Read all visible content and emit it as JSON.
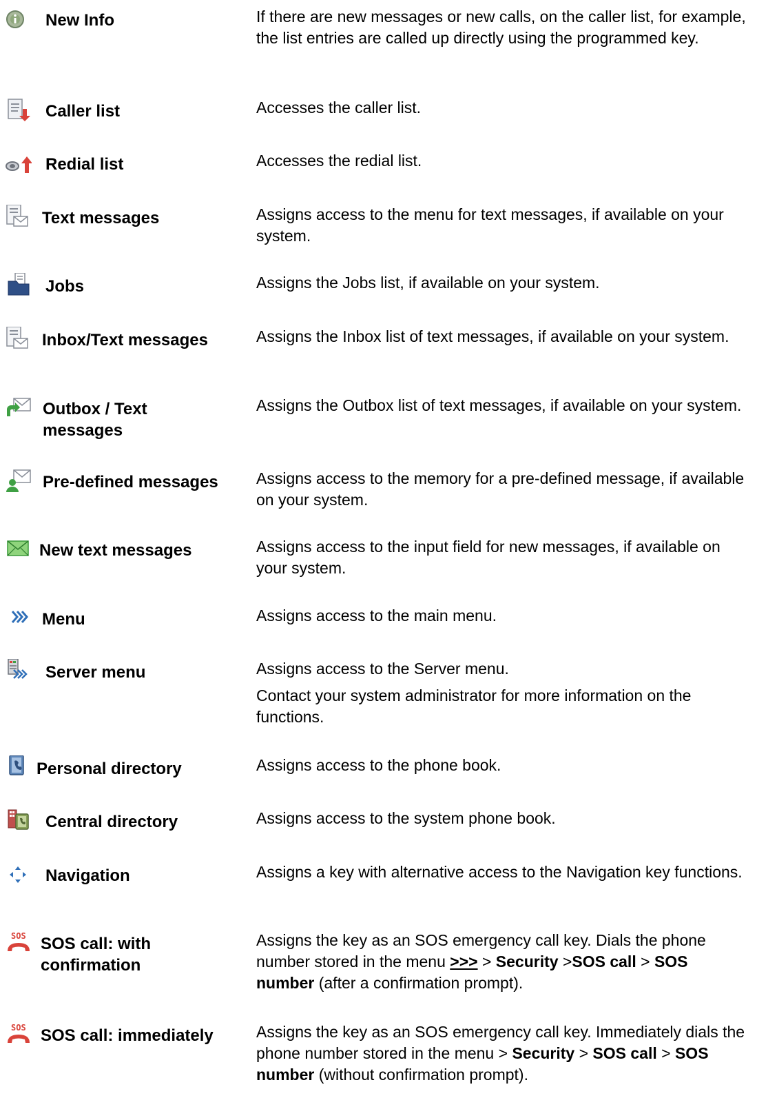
{
  "entries": [
    {
      "name": "New Info",
      "icon": "info-icon",
      "desc": "If there are new messages or new calls, on the caller list, for example, the list entries are called up directly using the programmed key."
    },
    {
      "name": "Caller list",
      "icon": "caller-list-icon",
      "desc": "Accesses the caller list."
    },
    {
      "name": "Redial list",
      "icon": "redial-list-icon",
      "desc": "Accesses the redial list."
    },
    {
      "name": "Text messages",
      "icon": "text-messages-icon",
      "desc": "Assigns access to the menu for text messages, if available on your system."
    },
    {
      "name": "Jobs",
      "icon": "jobs-icon",
      "desc": "Assigns the Jobs list, if available on your system."
    },
    {
      "name": "Inbox/Text messages",
      "icon": "inbox-icon",
      "desc": "Assigns the Inbox list of text messages, if available on your system."
    },
    {
      "name": "Outbox / Text messages",
      "icon": "outbox-icon",
      "desc": "Assigns the Outbox list of text messages, if available on your system."
    },
    {
      "name": "Pre-defined messages",
      "icon": "predefined-messages-icon",
      "desc": "Assigns access to the memory for a pre-defined message, if available on your system."
    },
    {
      "name": "New text messages",
      "icon": "new-message-envelope-icon",
      "desc": "Assigns access to the input field for new messages, if available on your system."
    },
    {
      "name": "Menu",
      "icon": "menu-chevrons-icon",
      "desc": "Assigns access to the main menu."
    },
    {
      "name": "Server menu",
      "icon": "server-menu-icon",
      "desc": "Assigns access to the Server menu.",
      "desc2": "Contact your system administrator for more information on the functions."
    },
    {
      "name": "Personal directory",
      "icon": "personal-directory-icon",
      "desc": "Assigns access to the phone book."
    },
    {
      "name": "Central directory",
      "icon": "central-directory-icon",
      "desc": "Assigns access to the system phone book."
    },
    {
      "name": "Navigation",
      "icon": "navigation-arrows-icon",
      "desc": "Assigns a key with alternative access to the Navigation key functions."
    },
    {
      "name": "SOS call: with confirmation",
      "icon": "sos-phone-icon",
      "desc_parts": {
        "t1": "Assigns the key as an SOS emergency call key. Dials the phone number stored in the menu ",
        "menu": ">>>",
        "sep1": " > ",
        "security": "Security",
        "sep2": " >",
        "sos_call": "SOS call",
        "sep3": " > ",
        "sos_number": "SOS number",
        "t2": " (after a confirmation prompt)."
      }
    },
    {
      "name": "SOS call: immediately",
      "icon": "sos-phone-icon",
      "desc_parts": {
        "t1": "Assigns the key as an SOS emergency call key. Immediately dials the phone number stored in the menu > ",
        "security": "Security",
        "sep1": " > ",
        "sos_call": "SOS call",
        "sep2": " > ",
        "sos_number": "SOS number",
        "t2": " (without confirmation prompt)."
      }
    }
  ]
}
